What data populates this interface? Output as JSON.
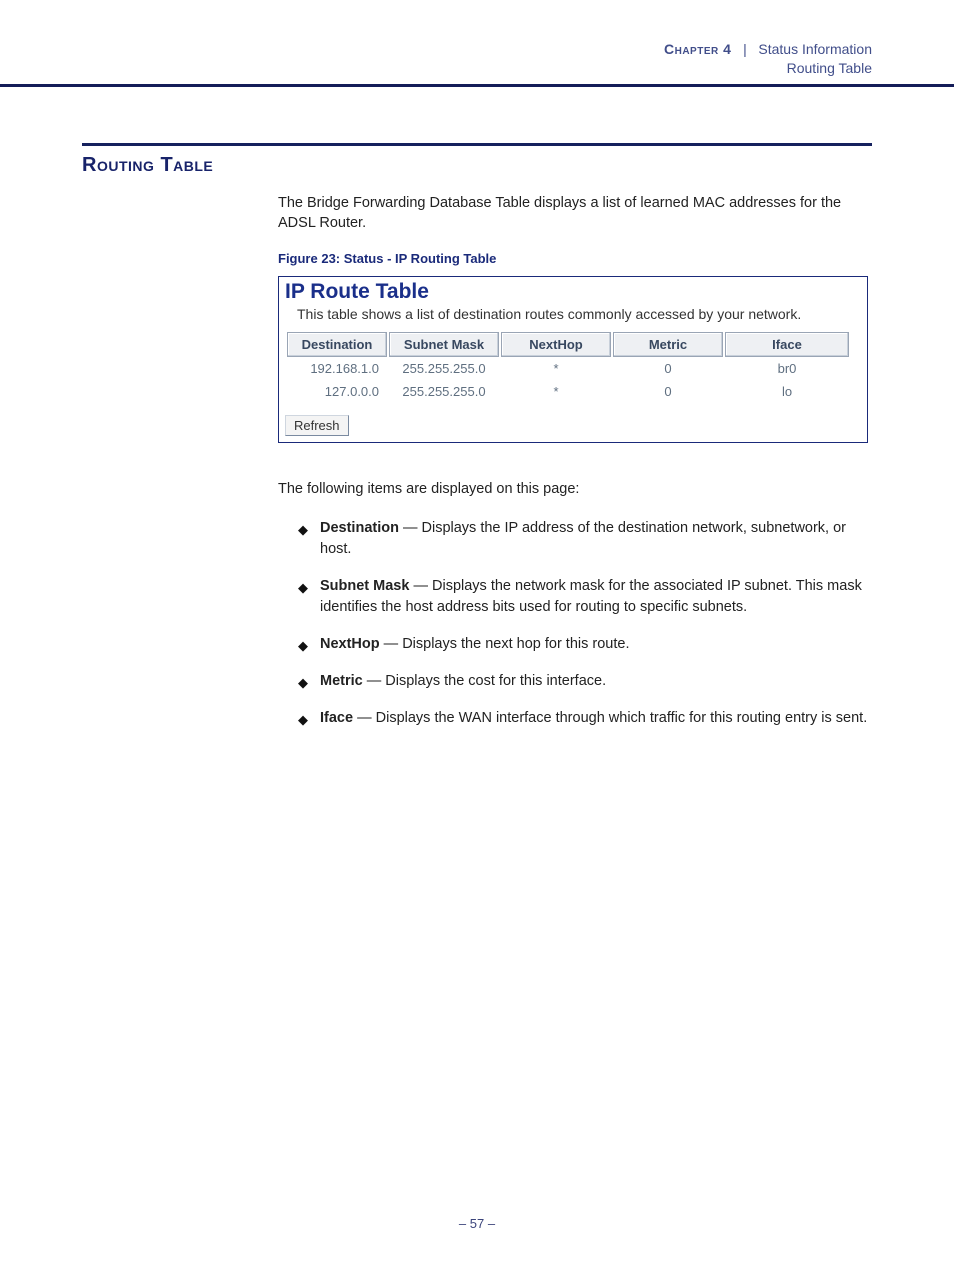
{
  "header": {
    "chapter_label": "Chapter 4",
    "separator": "|",
    "breadcrumb": "Status Information",
    "subheading": "Routing Table"
  },
  "section": {
    "title": "Routing Table",
    "intro": "The Bridge Forwarding Database Table displays a list of learned MAC addresses for the ADSL Router.",
    "figure_caption": "Figure 23:  Status - IP Routing Table"
  },
  "panel": {
    "title": "IP Route Table",
    "subtitle": "This table shows a list of destination routes commonly accessed by your network.",
    "columns": [
      "Destination",
      "Subnet Mask",
      "NextHop",
      "Metric",
      "Iface"
    ],
    "rows": [
      {
        "destination": "192.168.1.0",
        "mask": "255.255.255.0",
        "nexthop": "*",
        "metric": "0",
        "iface": "br0"
      },
      {
        "destination": "127.0.0.0",
        "mask": "255.255.255.0",
        "nexthop": "*",
        "metric": "0",
        "iface": "lo"
      }
    ],
    "refresh_label": "Refresh"
  },
  "items_intro": "The following items are displayed on this page:",
  "definitions": [
    {
      "term": "Destination",
      "desc": "Displays the IP address of the destination network, subnetwork, or host."
    },
    {
      "term": "Subnet Mask",
      "desc": "Displays the network mask for the associated IP subnet. This mask identifies the host address bits used for routing to specific subnets."
    },
    {
      "term": "NextHop",
      "desc": "Displays the next hop for this route."
    },
    {
      "term": "Metric",
      "desc": "Displays the cost for this interface."
    },
    {
      "term": "Iface",
      "desc": "Displays the WAN interface through which traffic for this routing entry is sent."
    }
  ],
  "page_number": "–  57  –"
}
